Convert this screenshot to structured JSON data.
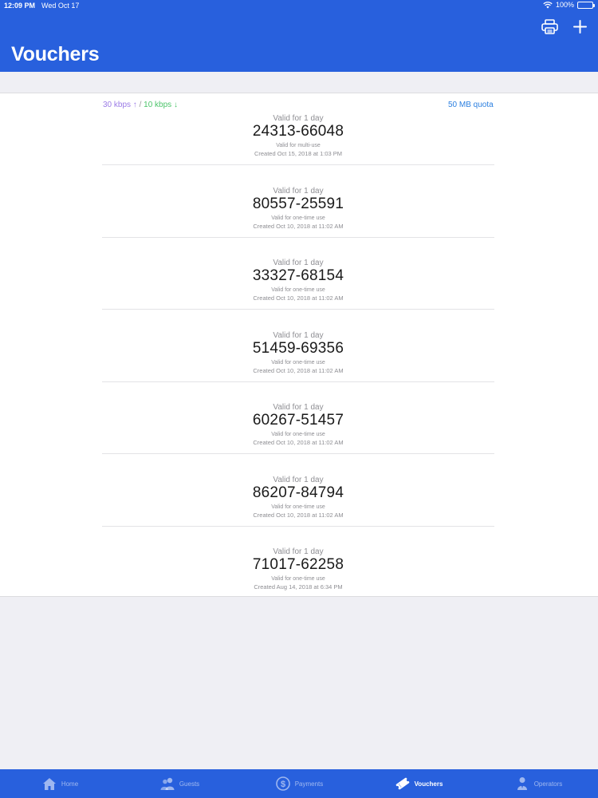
{
  "status": {
    "time": "12:09 PM",
    "date": "Wed Oct 17",
    "battery": "100%"
  },
  "header": {
    "title": "Vouchers"
  },
  "meta": {
    "up": "30 kbps ↑",
    "sep": " / ",
    "down": "10 kbps ↓",
    "quota": "50 MB quota"
  },
  "vouchers": [
    {
      "valid": "Valid for 1 day",
      "code": "24313-66048",
      "use": "Valid for multi-use",
      "created": "Created Oct 15, 2018 at 1:03 PM"
    },
    {
      "valid": "Valid for 1 day",
      "code": "80557-25591",
      "use": "Valid for one-time use",
      "created": "Created Oct 10, 2018 at 11:02 AM"
    },
    {
      "valid": "Valid for 1 day",
      "code": "33327-68154",
      "use": "Valid for one-time use",
      "created": "Created Oct 10, 2018 at 11:02 AM"
    },
    {
      "valid": "Valid for 1 day",
      "code": "51459-69356",
      "use": "Valid for one-time use",
      "created": "Created Oct 10, 2018 at 11:02 AM"
    },
    {
      "valid": "Valid for 1 day",
      "code": "60267-51457",
      "use": "Valid for one-time use",
      "created": "Created Oct 10, 2018 at 11:02 AM"
    },
    {
      "valid": "Valid for 1 day",
      "code": "86207-84794",
      "use": "Valid for one-time use",
      "created": "Created Oct 10, 2018 at 11:02 AM"
    },
    {
      "valid": "Valid for 1 day",
      "code": "71017-62258",
      "use": "Valid for one-time use",
      "created": "Created Aug 14, 2018 at 6:34 PM"
    }
  ],
  "tabs": [
    {
      "label": "Home",
      "icon": "home-icon"
    },
    {
      "label": "Guests",
      "icon": "guests-icon"
    },
    {
      "label": "Payments",
      "icon": "payments-icon"
    },
    {
      "label": "Vouchers",
      "icon": "vouchers-icon"
    },
    {
      "label": "Operators",
      "icon": "operators-icon"
    }
  ],
  "colors": {
    "brand": "#2860dd",
    "up": "#9b7be6",
    "down": "#4cc46a",
    "quota": "#2b7fe0"
  }
}
